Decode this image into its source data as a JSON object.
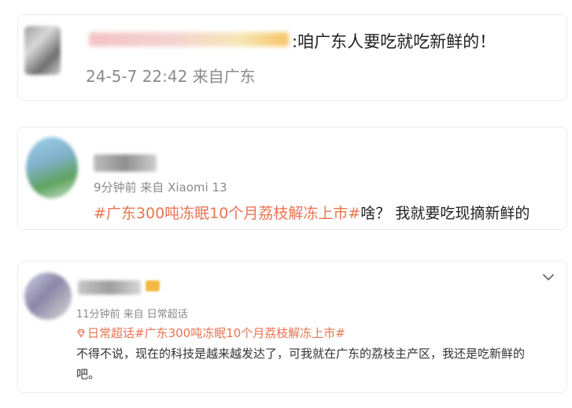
{
  "comments": [
    {
      "text": ":咱广东人要吃就吃新鲜的！",
      "meta": "24-5-7 22:42 来自广东"
    },
    {
      "meta": "9分钟前 来自 Xiaomi 13",
      "topic": "#广东300吨冻眠10个月荔枝解冻上市#",
      "text": "啥？ 我就要吃现摘新鲜的"
    },
    {
      "meta": "11分钟前 来自 日常超话",
      "topic": "日常超话#广东300吨冻眠10个月荔枝解冻上市#",
      "text_line1": "不得不说，现在的科技是越来越发达了，可我就在广东的荔枝主产区，我还是吃新鲜的",
      "text_line2": "吧。"
    }
  ],
  "colors": {
    "topic": "#eb7350",
    "meta": "#8a8a8a",
    "text": "#222222"
  },
  "icons": {
    "chevron": "chevron-down-icon",
    "supertopic": "supertopic-gem-icon"
  }
}
